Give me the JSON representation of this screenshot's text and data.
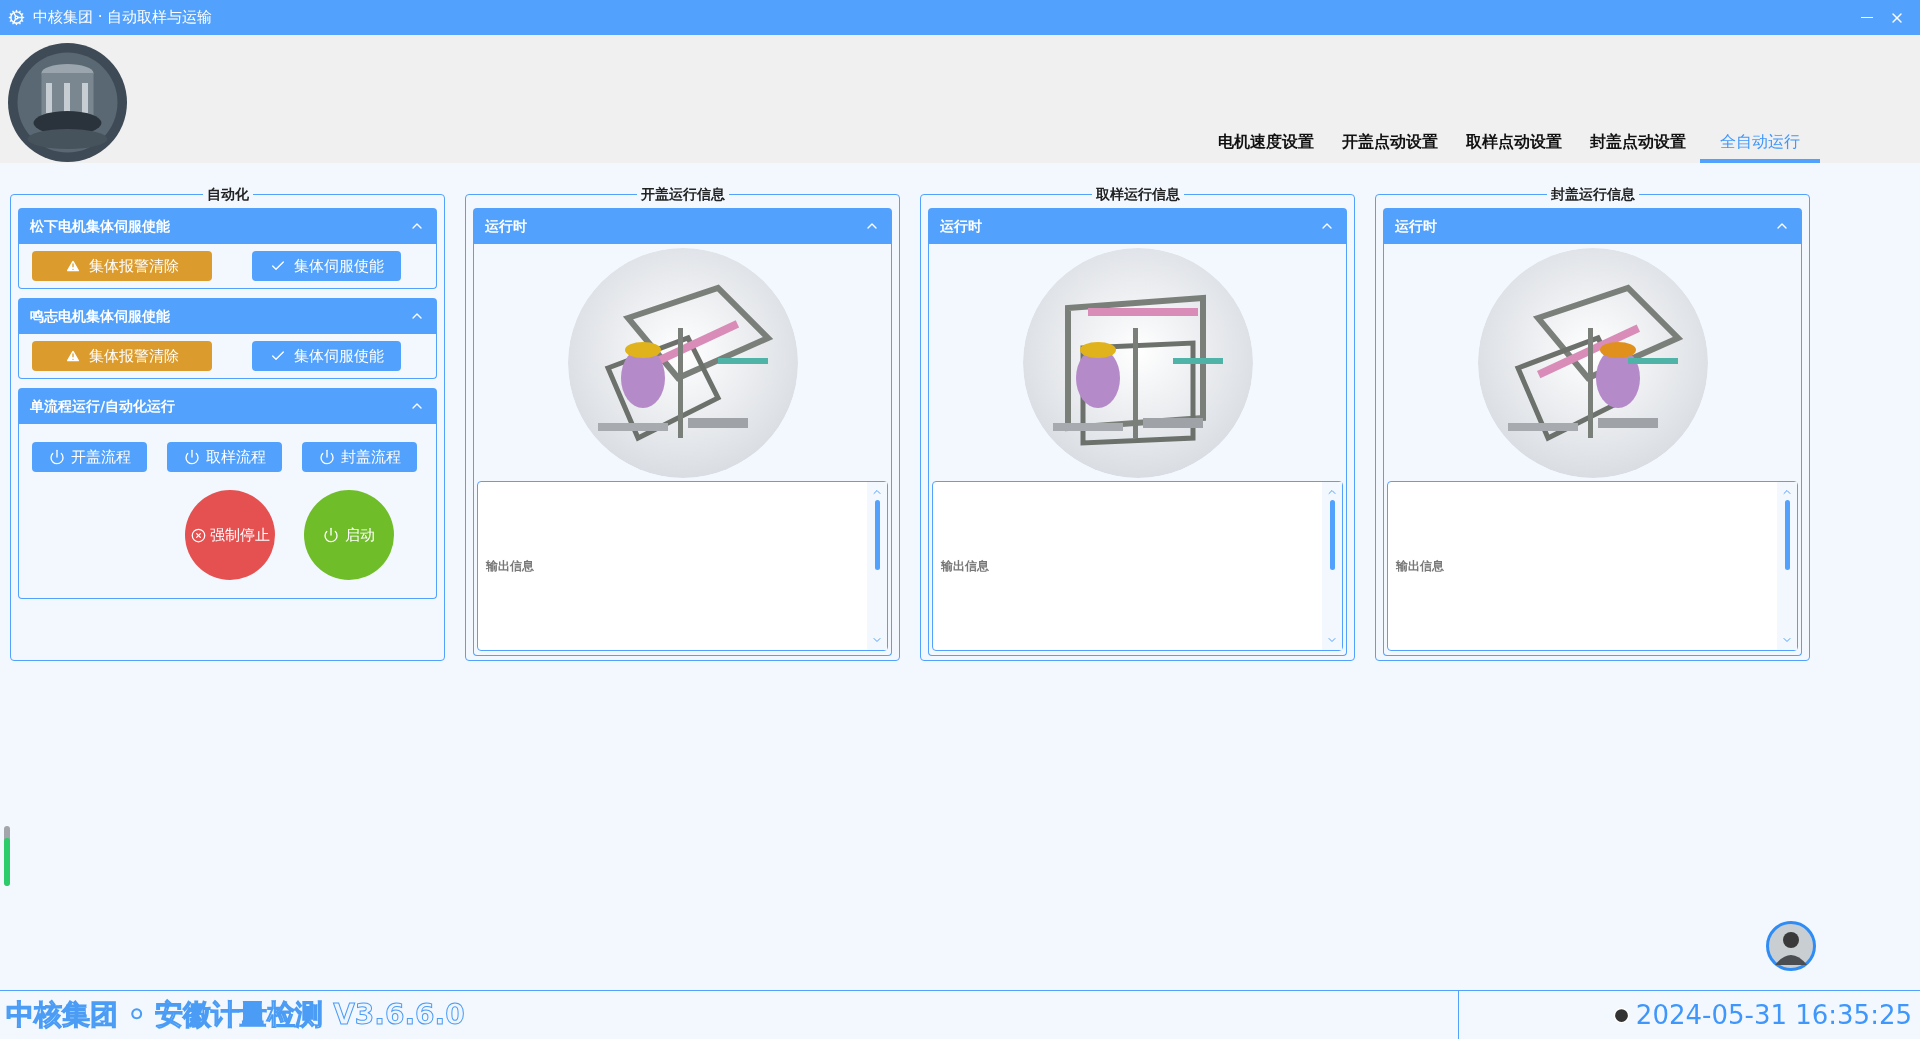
{
  "window": {
    "title": "中核集团 · 自动取样与运输"
  },
  "tabs": [
    {
      "label": "电机速度设置",
      "selected": false
    },
    {
      "label": "开盖点动设置",
      "selected": false
    },
    {
      "label": "取样点动设置",
      "selected": false
    },
    {
      "label": "封盖点动设置",
      "selected": false
    },
    {
      "label": "全自动运行",
      "selected": true
    }
  ],
  "automation": {
    "legend": "自动化",
    "sections": [
      {
        "title": "松下电机集体伺服使能",
        "expanded": true,
        "buttons": [
          {
            "kind": "warning",
            "label": "集体报警清除"
          },
          {
            "kind": "confirm",
            "label": "集体伺服使能"
          }
        ]
      },
      {
        "title": "鸣志电机集体伺服使能",
        "expanded": true,
        "buttons": [
          {
            "kind": "warning",
            "label": "集体报警清除"
          },
          {
            "kind": "confirm",
            "label": "集体伺服使能"
          }
        ]
      }
    ],
    "process": {
      "title": "单流程运行/自动化运行",
      "expanded": true,
      "buttons": [
        {
          "label": "开盖流程"
        },
        {
          "label": "取样流程"
        },
        {
          "label": "封盖流程"
        }
      ],
      "stop": {
        "label": "强制停止"
      },
      "start": {
        "label": "启动"
      }
    }
  },
  "monitors": [
    {
      "legend": "开盖运行信息",
      "header": "运行时",
      "expanded": true,
      "output": "输出信息"
    },
    {
      "legend": "取样运行信息",
      "header": "运行时",
      "expanded": true,
      "output": "输出信息"
    },
    {
      "legend": "封盖运行信息",
      "header": "运行时",
      "expanded": true,
      "output": "输出信息"
    }
  ],
  "meter": {
    "level": 0.8
  },
  "footer": {
    "brand": "中核集团 ◦ 安徽计量检测 V3.6.6.0",
    "datetime": "2024-05-31 16:35:25"
  }
}
